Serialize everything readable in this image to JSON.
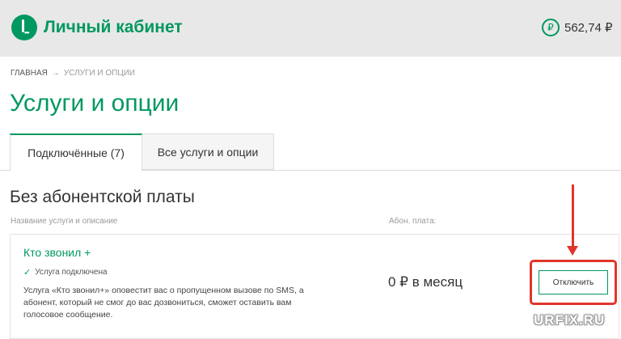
{
  "header": {
    "brand_title": "Личный кабинет",
    "balance": "562,74 ₽",
    "balance_icon": "ruble-circle-icon",
    "logo_icon": "megafon-logo-icon",
    "brand_color": "#00985f",
    "background": "#e8e8e8"
  },
  "breadcrumb": {
    "items": [
      "ГЛАВНАЯ",
      "УСЛУГИ И ОПЦИИ"
    ],
    "separator": "→"
  },
  "page_title": "Услуги и опции",
  "tabs": [
    {
      "label": "Подключённые (7)",
      "active": true
    },
    {
      "label": "Все услуги и опции",
      "active": false
    }
  ],
  "section": {
    "title": "Без абонентской платы",
    "col_name": "Название услуги и описание",
    "col_fee": "Абон. плата:"
  },
  "service": {
    "name": "Кто звонил +",
    "status": "Услуга подключена",
    "status_icon": "check-icon",
    "description": "Услуга «Кто звонил+» оповестит вас о пропущенном вызове по SMS, а абонент, который не смог до вас дозвониться, сможет оставить вам голосовое сообщение.",
    "price": "0 ₽ в месяц",
    "action_label": "Отключить"
  },
  "annotation": {
    "highlight_color": "#e0352b"
  },
  "watermark": "URFIX.RU"
}
